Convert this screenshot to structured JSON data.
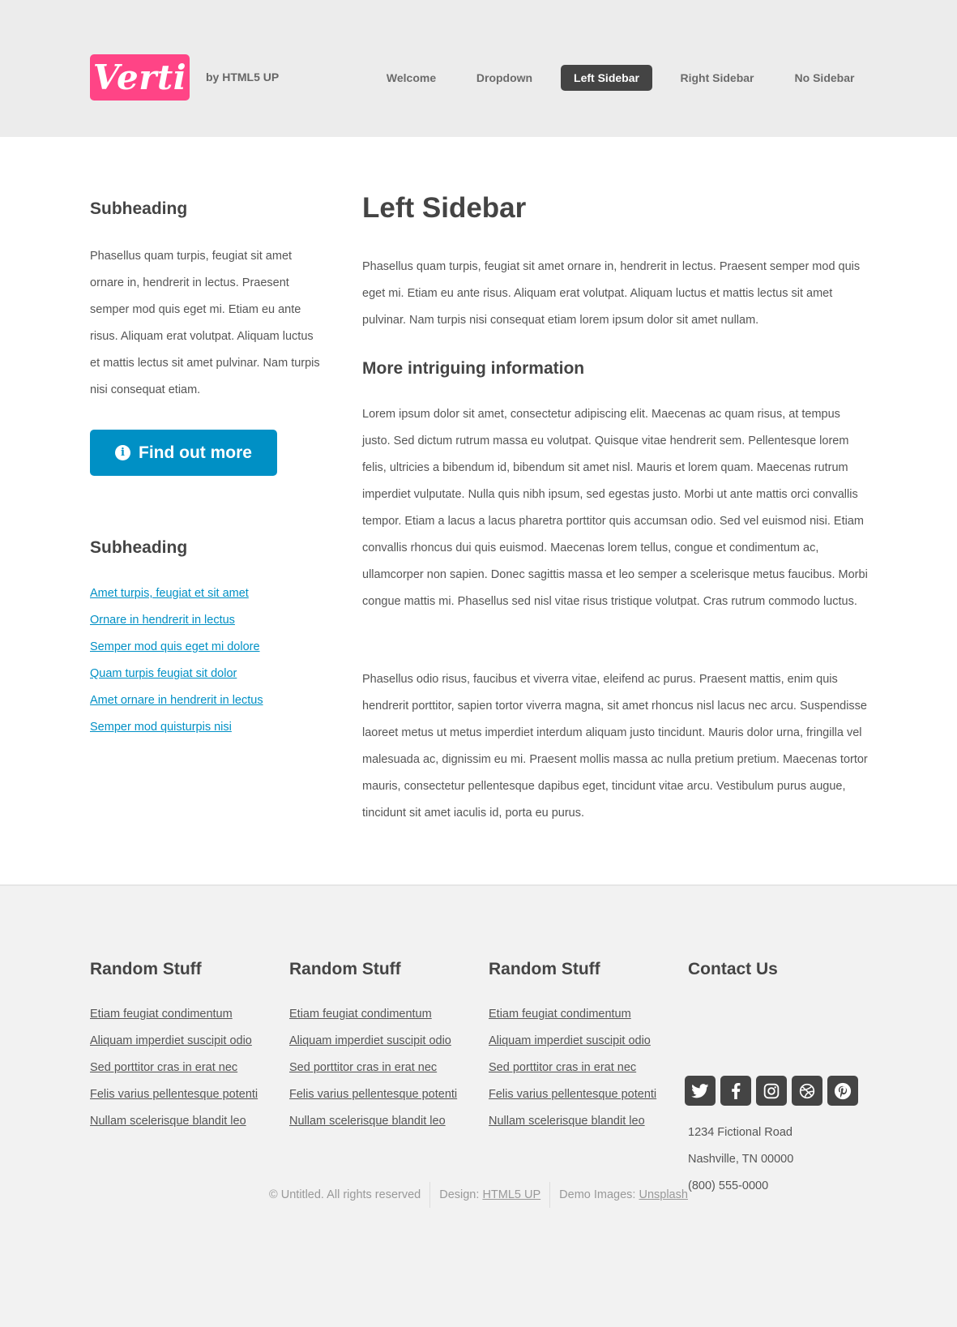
{
  "header": {
    "logo": "Verti",
    "byline": "by HTML5 UP",
    "nav": [
      "Welcome",
      "Dropdown",
      "Left Sidebar",
      "Right Sidebar",
      "No Sidebar"
    ],
    "active_nav": "Left Sidebar"
  },
  "sidebar": {
    "heading1": "Subheading",
    "paragraph": "Phasellus quam turpis, feugiat sit amet ornare in, hendrerit in lectus. Praesent semper mod quis eget mi. Etiam eu ante risus. Aliquam erat volutpat. Aliquam luctus et mattis lectus sit amet pulvinar. Nam turpis nisi consequat etiam.",
    "button_label": "Find out more",
    "button_icon": "info-icon",
    "heading2": "Subheading",
    "links": [
      "Amet turpis, feugiat et sit amet",
      "Ornare in hendrerit in lectus",
      "Semper mod quis eget mi dolore",
      "Quam turpis feugiat sit dolor",
      "Amet ornare in hendrerit in lectus",
      "Semper mod quisturpis nisi"
    ]
  },
  "content": {
    "title": "Left Sidebar",
    "para1": "Phasellus quam turpis, feugiat sit amet ornare in, hendrerit in lectus. Praesent semper mod quis eget mi. Etiam eu ante risus. Aliquam erat volutpat. Aliquam luctus et mattis lectus sit amet pulvinar. Nam turpis nisi consequat etiam lorem ipsum dolor sit amet nullam.",
    "subheading": "More intriguing information",
    "para2": "Lorem ipsum dolor sit amet, consectetur adipiscing elit. Maecenas ac quam risus, at tempus justo. Sed dictum rutrum massa eu volutpat. Quisque vitae hendrerit sem. Pellentesque lorem felis, ultricies a bibendum id, bibendum sit amet nisl. Mauris et lorem quam. Maecenas rutrum imperdiet vulputate. Nulla quis nibh ipsum, sed egestas justo. Morbi ut ante mattis orci convallis tempor. Etiam a lacus a lacus pharetra porttitor quis accumsan odio. Sed vel euismod nisi. Etiam convallis rhoncus dui quis euismod. Maecenas lorem tellus, congue et condimentum ac, ullamcorper non sapien. Donec sagittis massa et leo semper a scelerisque metus faucibus. Morbi congue mattis mi. Phasellus sed nisl vitae risus tristique volutpat. Cras rutrum commodo luctus.",
    "para3": "Phasellus odio risus, faucibus et viverra vitae, eleifend ac purus. Praesent mattis, enim quis hendrerit porttitor, sapien tortor viverra magna, sit amet rhoncus nisl lacus nec arcu. Suspendisse laoreet metus ut metus imperdiet interdum aliquam justo tincidunt. Mauris dolor urna, fringilla vel malesuada ac, dignissim eu mi. Praesent mollis massa ac nulla pretium pretium. Maecenas tortor mauris, consectetur pellentesque dapibus eget, tincidunt vitae arcu. Vestibulum purus augue, tincidunt sit amet iaculis id, porta eu purus."
  },
  "footer": {
    "columns": [
      {
        "heading": "Random Stuff",
        "links": [
          "Etiam feugiat condimentum",
          "Aliquam imperdiet suscipit odio",
          "Sed porttitor cras in erat nec",
          "Felis varius pellentesque potenti",
          "Nullam scelerisque blandit leo"
        ]
      },
      {
        "heading": "Random Stuff",
        "links": [
          "Etiam feugiat condimentum",
          "Aliquam imperdiet suscipit odio",
          "Sed porttitor cras in erat nec",
          "Felis varius pellentesque potenti",
          "Nullam scelerisque blandit leo"
        ]
      },
      {
        "heading": "Random Stuff",
        "links": [
          "Etiam feugiat condimentum",
          "Aliquam imperdiet suscipit odio",
          "Sed porttitor cras in erat nec",
          "Felis varius pellentesque potenti",
          "Nullam scelerisque blandit leo"
        ]
      }
    ],
    "contact": {
      "heading": "Contact Us",
      "socials": [
        "twitter-icon",
        "facebook-icon",
        "instagram-icon",
        "dribbble-icon",
        "pinterest-icon"
      ],
      "address1": "1234 Fictional Road",
      "address2": "Nashville, TN 00000",
      "phone": "(800) 555-0000"
    },
    "copyright": {
      "text": "© Untitled. All rights reserved",
      "design_label": "Design:",
      "design_link": "HTML5 UP",
      "images_label": "Demo Images:",
      "images_link": "Unsplash"
    }
  },
  "colors": {
    "logo_bg": "#ff4486",
    "accent": "#0090c5",
    "nav_active_bg": "#444444",
    "text": "#555555"
  }
}
